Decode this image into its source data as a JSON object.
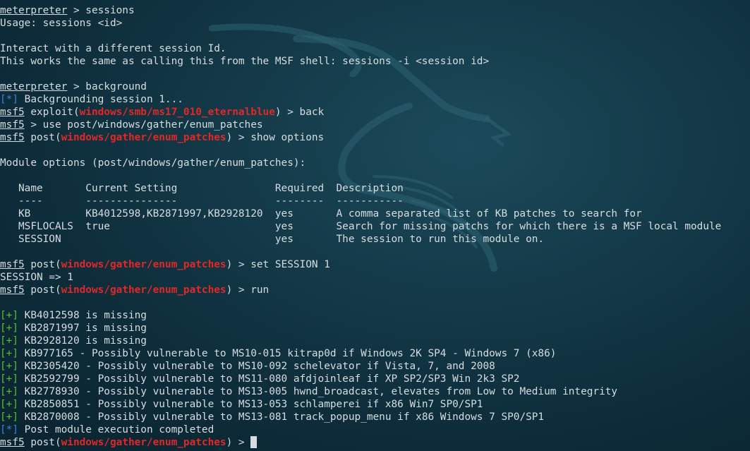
{
  "terminal": {
    "prompt_meterpreter": "meterpreter",
    "prompt_msf": "msf5",
    "cmd_sessions": " > sessions",
    "usage": "Usage: sessions <id>",
    "interact_desc": "Interact with a different session Id.",
    "works_same": "This works the same as calling this from the MSF shell: sessions -i <session id>",
    "cmd_background": " > background",
    "bg_marker": "[*]",
    "bg_text": " Backgrounding session 1...",
    "exploit_prefix": " exploit(",
    "exploit_module": "windows/smb/ms17_010_eternalblue",
    "cmd_back": ") > back",
    "cmd_use": " > use post/windows/gather/enum_patches",
    "post_prefix": " post(",
    "post_module": "windows/gather/enum_patches",
    "cmd_show_options": ") > show options",
    "module_options_title": "Module options (post/windows/gather/enum_patches):",
    "options_header": "   Name       Current Setting                Required  Description",
    "options_divider": "   ----       ---------------                --------  -----------",
    "options_rows": [
      "   KB         KB4012598,KB2871997,KB2928120  yes       A comma separated list of KB patches to search for",
      "   MSFLOCALS  true                           yes       Search for missing patchs for which there is a MSF local module",
      "   SESSION                                   yes       The session to run this module on."
    ],
    "cmd_set_session": ") > set SESSION 1",
    "session_result": "SESSION => 1",
    "cmd_run": ") > run",
    "plus_marker": "[+]",
    "star_marker": "[*]",
    "results": [
      " KB4012598 is missing",
      " KB2871997 is missing",
      " KB2928120 is missing",
      " KB977165 - Possibly vulnerable to MS10-015 kitrap0d if Windows 2K SP4 - Windows 7 (x86)",
      " KB2305420 - Possibly vulnerable to MS10-092 schelevator if Vista, 7, and 2008",
      " KB2592799 - Possibly vulnerable to MS11-080 afdjoinleaf if XP SP2/SP3 Win 2k3 SP2",
      " KB2778930 - Possibly vulnerable to MS13-005 hwnd_broadcast, elevates from Low to Medium integrity",
      " KB2850851 - Possibly vulnerable to MS13-053 schlamperei if x86 Win7 SP0/SP1",
      " KB2870008 - Possibly vulnerable to MS13-081 track_popup_menu if x86 Windows 7 SP0/SP1"
    ],
    "completed": " Post module execution completed",
    "final_prompt_suffix": ") > "
  },
  "colors": {
    "background": "#143a49",
    "text": "#d6dde2",
    "module_red": "#e12828",
    "info_blue": "#3f7fe0",
    "success_green": "#56c234"
  }
}
